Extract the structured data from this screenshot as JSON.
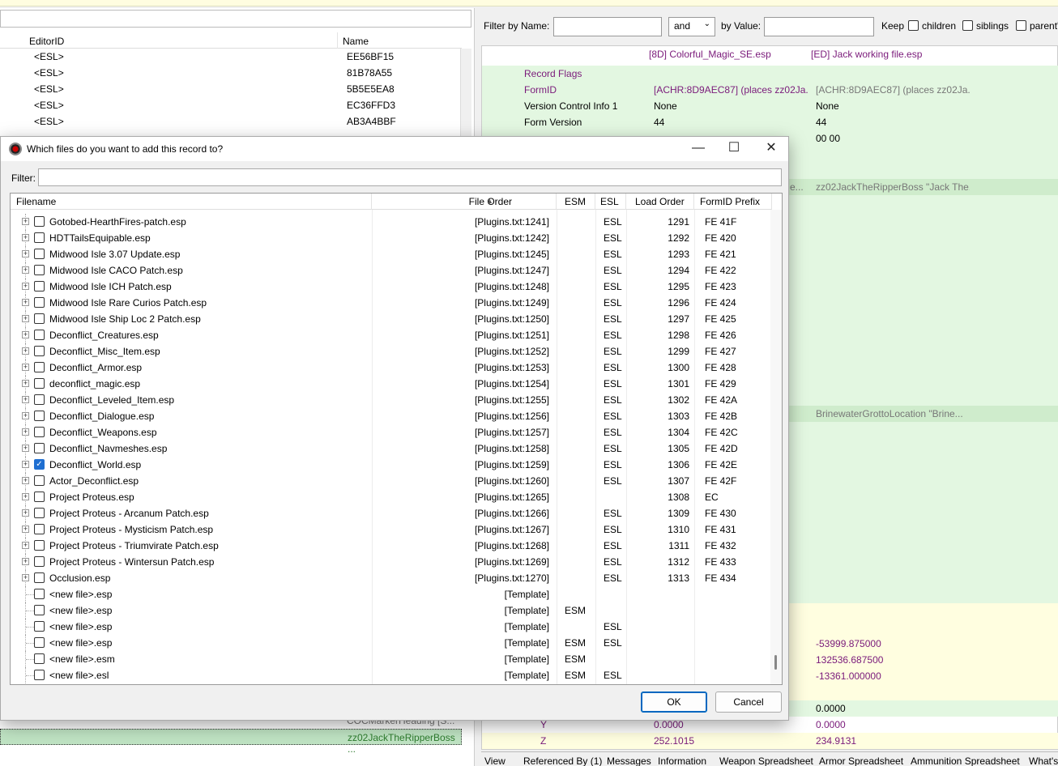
{
  "left_pane": {
    "columns": [
      "EditorID",
      "Name"
    ],
    "rows": [
      {
        "editor_id": "<ESL>",
        "name": "EE56BF15"
      },
      {
        "editor_id": "<ESL>",
        "name": "81B78A55"
      },
      {
        "editor_id": "<ESL>",
        "name": "5B5E5EA8"
      },
      {
        "editor_id": "<ESL>",
        "name": "EC36FFD3"
      },
      {
        "editor_id": "<ESL>",
        "name": "AB3A4BBF"
      }
    ],
    "bottom_row_name": "zz02JackTheRipperBoss ...",
    "bottom_row_prev": "COCMarkerHeading [S..."
  },
  "filterbar": {
    "filter_by_name_label": "Filter by Name:",
    "name_value": "",
    "operator": "and",
    "by_value_label": "by Value:",
    "value_value": "",
    "keep_label": "Keep",
    "children_label": "children",
    "siblings_label": "siblings",
    "parent_label": "parent'"
  },
  "right_pane": {
    "header_col1": "[8D] Colorful_Magic_SE.esp",
    "header_col2": "[ED] Jack working file.esp",
    "rows": [
      {
        "label": "Record Flags",
        "v1": "",
        "v2": ""
      },
      {
        "label": "FormID",
        "v1": "[ACHR:8D9AEC87] (places zz02Ja...",
        "v2": "[ACHR:8D9AEC87] (places zz02Ja..."
      },
      {
        "label": "Version Control Info 1",
        "v1": "None",
        "v2": "None"
      },
      {
        "label": "Form Version",
        "v1": "44",
        "v2": "44"
      }
    ],
    "row_0000": "00 00",
    "row_base": "zz02JackTheRipperBoss \"Jack The...",
    "row_base_prefix": "e...",
    "row_location": "BrinewaterGrottoLocation \"Brine...",
    "pos_x": "-53999.875000",
    "pos_y": "132536.687500",
    "pos_z": "-13361.000000",
    "rot_x": "0.0000",
    "rot_y_label": "Y",
    "rot_y_v1": "0.0000",
    "rot_y_v2": "0.0000",
    "rot_z_label": "Z",
    "rot_z_v1": "252.1015",
    "rot_z_v2": "234.9131"
  },
  "bottom_tabs": [
    "View",
    "Referenced By (1)",
    "Messages",
    "Information",
    "Weapon Spreadsheet",
    "Armor Spreadsheet",
    "Ammunition Spreadsheet",
    "What's"
  ],
  "dialog": {
    "title": "Which files do you want to add this record to?",
    "filter_label": "Filter:",
    "filter_value": "",
    "columns": {
      "filename": "Filename",
      "file_order": "File Order",
      "esm": "ESM",
      "esl": "ESL",
      "load_order": "Load Order",
      "prefix": "FormID Prefix"
    },
    "rows": [
      {
        "file": "Gotobed-HearthFires-patch.esp",
        "order": "[Plugins.txt:1241]",
        "esm": "",
        "esl": "ESL",
        "load": "1291",
        "prefix": "FE 41F",
        "checked": false,
        "expander": true
      },
      {
        "file": "HDTTailsEquipable.esp",
        "order": "[Plugins.txt:1242]",
        "esm": "",
        "esl": "ESL",
        "load": "1292",
        "prefix": "FE 420",
        "checked": false,
        "expander": true
      },
      {
        "file": "Midwood Isle 3.07 Update.esp",
        "order": "[Plugins.txt:1245]",
        "esm": "",
        "esl": "ESL",
        "load": "1293",
        "prefix": "FE 421",
        "checked": false,
        "expander": true
      },
      {
        "file": "Midwood Isle CACO Patch.esp",
        "order": "[Plugins.txt:1247]",
        "esm": "",
        "esl": "ESL",
        "load": "1294",
        "prefix": "FE 422",
        "checked": false,
        "expander": true
      },
      {
        "file": "Midwood Isle ICH Patch.esp",
        "order": "[Plugins.txt:1248]",
        "esm": "",
        "esl": "ESL",
        "load": "1295",
        "prefix": "FE 423",
        "checked": false,
        "expander": true
      },
      {
        "file": "Midwood Isle Rare Curios Patch.esp",
        "order": "[Plugins.txt:1249]",
        "esm": "",
        "esl": "ESL",
        "load": "1296",
        "prefix": "FE 424",
        "checked": false,
        "expander": true
      },
      {
        "file": "Midwood Isle Ship Loc 2 Patch.esp",
        "order": "[Plugins.txt:1250]",
        "esm": "",
        "esl": "ESL",
        "load": "1297",
        "prefix": "FE 425",
        "checked": false,
        "expander": true
      },
      {
        "file": "Deconflict_Creatures.esp",
        "order": "[Plugins.txt:1251]",
        "esm": "",
        "esl": "ESL",
        "load": "1298",
        "prefix": "FE 426",
        "checked": false,
        "expander": true
      },
      {
        "file": "Deconflict_Misc_Item.esp",
        "order": "[Plugins.txt:1252]",
        "esm": "",
        "esl": "ESL",
        "load": "1299",
        "prefix": "FE 427",
        "checked": false,
        "expander": true
      },
      {
        "file": "Deconflict_Armor.esp",
        "order": "[Plugins.txt:1253]",
        "esm": "",
        "esl": "ESL",
        "load": "1300",
        "prefix": "FE 428",
        "checked": false,
        "expander": true
      },
      {
        "file": "deconflict_magic.esp",
        "order": "[Plugins.txt:1254]",
        "esm": "",
        "esl": "ESL",
        "load": "1301",
        "prefix": "FE 429",
        "checked": false,
        "expander": true
      },
      {
        "file": "Deconflict_Leveled_Item.esp",
        "order": "[Plugins.txt:1255]",
        "esm": "",
        "esl": "ESL",
        "load": "1302",
        "prefix": "FE 42A",
        "checked": false,
        "expander": true
      },
      {
        "file": "Deconflict_Dialogue.esp",
        "order": "[Plugins.txt:1256]",
        "esm": "",
        "esl": "ESL",
        "load": "1303",
        "prefix": "FE 42B",
        "checked": false,
        "expander": true
      },
      {
        "file": "Deconflict_Weapons.esp",
        "order": "[Plugins.txt:1257]",
        "esm": "",
        "esl": "ESL",
        "load": "1304",
        "prefix": "FE 42C",
        "checked": false,
        "expander": true
      },
      {
        "file": "Deconflict_Navmeshes.esp",
        "order": "[Plugins.txt:1258]",
        "esm": "",
        "esl": "ESL",
        "load": "1305",
        "prefix": "FE 42D",
        "checked": false,
        "expander": true
      },
      {
        "file": "Deconflict_World.esp",
        "order": "[Plugins.txt:1259]",
        "esm": "",
        "esl": "ESL",
        "load": "1306",
        "prefix": "FE 42E",
        "checked": true,
        "expander": true
      },
      {
        "file": "Actor_Deconflict.esp",
        "order": "[Plugins.txt:1260]",
        "esm": "",
        "esl": "ESL",
        "load": "1307",
        "prefix": "FE 42F",
        "checked": false,
        "expander": true
      },
      {
        "file": "Project Proteus.esp",
        "order": "[Plugins.txt:1265]",
        "esm": "",
        "esl": "",
        "load": "1308",
        "prefix": "EC",
        "checked": false,
        "expander": true
      },
      {
        "file": "Project Proteus - Arcanum Patch.esp",
        "order": "[Plugins.txt:1266]",
        "esm": "",
        "esl": "ESL",
        "load": "1309",
        "prefix": "FE 430",
        "checked": false,
        "expander": true
      },
      {
        "file": "Project Proteus - Mysticism Patch.esp",
        "order": "[Plugins.txt:1267]",
        "esm": "",
        "esl": "ESL",
        "load": "1310",
        "prefix": "FE 431",
        "checked": false,
        "expander": true
      },
      {
        "file": "Project Proteus - Triumvirate Patch.esp",
        "order": "[Plugins.txt:1268]",
        "esm": "",
        "esl": "ESL",
        "load": "1311",
        "prefix": "FE 432",
        "checked": false,
        "expander": true
      },
      {
        "file": "Project Proteus - Wintersun Patch.esp",
        "order": "[Plugins.txt:1269]",
        "esm": "",
        "esl": "ESL",
        "load": "1312",
        "prefix": "FE 433",
        "checked": false,
        "expander": true
      },
      {
        "file": "Occlusion.esp",
        "order": "[Plugins.txt:1270]",
        "esm": "",
        "esl": "ESL",
        "load": "1313",
        "prefix": "FE 434",
        "checked": false,
        "expander": true
      },
      {
        "file": "<new file>.esp",
        "order": "[Template]",
        "esm": "",
        "esl": "",
        "load": "",
        "prefix": "",
        "checked": false,
        "expander": false
      },
      {
        "file": "<new file>.esp",
        "order": "[Template]",
        "esm": "ESM",
        "esl": "",
        "load": "",
        "prefix": "",
        "checked": false,
        "expander": false
      },
      {
        "file": "<new file>.esp",
        "order": "[Template]",
        "esm": "",
        "esl": "ESL",
        "load": "",
        "prefix": "",
        "checked": false,
        "expander": false
      },
      {
        "file": "<new file>.esp",
        "order": "[Template]",
        "esm": "ESM",
        "esl": "ESL",
        "load": "",
        "prefix": "",
        "checked": false,
        "expander": false
      },
      {
        "file": "<new file>.esm",
        "order": "[Template]",
        "esm": "ESM",
        "esl": "",
        "load": "",
        "prefix": "",
        "checked": false,
        "expander": false
      },
      {
        "file": "<new file>.esl",
        "order": "[Template]",
        "esm": "ESM",
        "esl": "ESL",
        "load": "",
        "prefix": "",
        "checked": false,
        "expander": false
      }
    ],
    "ok_label": "OK",
    "cancel_label": "Cancel"
  }
}
